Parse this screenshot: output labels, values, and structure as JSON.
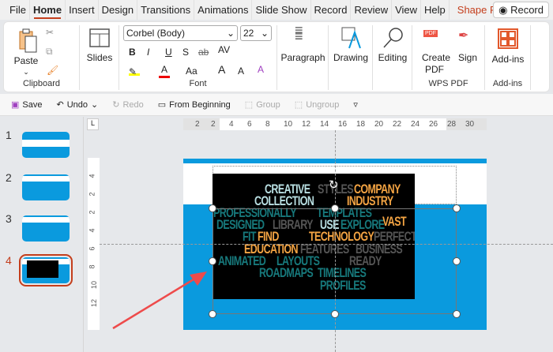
{
  "tabs": [
    "File",
    "Home",
    "Insert",
    "Design",
    "Transitions",
    "Animations",
    "Slide Show",
    "Record",
    "Review",
    "View",
    "Help"
  ],
  "contextual_tab": "Shape Format",
  "record_button": "Record",
  "ribbon": {
    "clipboard": {
      "paste": "Paste",
      "label": "Clipboard"
    },
    "slides": {
      "label": "Slides"
    },
    "font": {
      "name": "Corbel (Body)",
      "size": "22",
      "label": "Font",
      "bold": "B",
      "italic": "I",
      "underline": "U",
      "shadow": "S",
      "strike": "ab",
      "spacing": "AV",
      "case": "Aa",
      "grow": "A",
      "shrink": "A",
      "highlight_color": "#ffff00",
      "font_color": "#e00000"
    },
    "paragraph": "Paragraph",
    "drawing": "Drawing",
    "editing": "Editing",
    "wps": {
      "create": "Create",
      "pdf": "PDF",
      "sign": "Sign",
      "label": "WPS PDF",
      "badge": "PDF"
    },
    "addins": {
      "button": "Add-ins",
      "label": "Add-ins"
    }
  },
  "qat": {
    "save": "Save",
    "undo": "Undo",
    "redo": "Redo",
    "from_beginning": "From Beginning",
    "group": "Group",
    "ungroup": "Ungroup"
  },
  "slides": [
    {
      "num": "1"
    },
    {
      "num": "2"
    },
    {
      "num": "3"
    },
    {
      "num": "4",
      "selected": true
    }
  ],
  "ruler_h": [
    "2",
    "2",
    "4",
    "6",
    "8",
    "10",
    "12",
    "14",
    "16",
    "18",
    "20",
    "22",
    "24",
    "26",
    "28",
    "30"
  ],
  "ruler_v": [
    "4",
    "2",
    "2",
    "4",
    "6",
    "8",
    "10",
    "12"
  ],
  "colors": {
    "accent": "#c43e1c",
    "slide_blue": "#0a9ade",
    "teal": "#17797c",
    "orange": "#f4a443",
    "light": "#b9dfe2",
    "gray": "#555555",
    "arrow": "#ee4b4b"
  },
  "word_cloud": [
    {
      "t": "CREATIVE",
      "c": "light"
    },
    {
      "t": "STYLES",
      "c": "gray"
    },
    {
      "t": "COMPANY",
      "c": "orange"
    },
    {
      "t": "COLLECTION",
      "c": "light"
    },
    {
      "t": "INDUSTRY",
      "c": "orange"
    },
    {
      "t": "PROFESSIONALLY",
      "c": "teal"
    },
    {
      "t": "TEMPLATES",
      "c": "teal"
    },
    {
      "t": "DESIGNED",
      "c": "teal"
    },
    {
      "t": "LIBRARY",
      "c": "gray"
    },
    {
      "t": "USE",
      "c": "light"
    },
    {
      "t": "EXPLORE",
      "c": "teal"
    },
    {
      "t": "VAST",
      "c": "orange"
    },
    {
      "t": "FIT",
      "c": "teal"
    },
    {
      "t": "FIND",
      "c": "orange"
    },
    {
      "t": "TECHNOLOGY",
      "c": "orange"
    },
    {
      "t": "PERFECT",
      "c": "gray"
    },
    {
      "t": "EDUCATION",
      "c": "orange"
    },
    {
      "t": "FEATURES",
      "c": "gray"
    },
    {
      "t": "BUSINESS",
      "c": "gray"
    },
    {
      "t": "ANIMATED",
      "c": "teal"
    },
    {
      "t": "LAYOUTS",
      "c": "teal"
    },
    {
      "t": "READY",
      "c": "gray"
    },
    {
      "t": "ROADMAPS",
      "c": "teal"
    },
    {
      "t": "TIMELINES",
      "c": "teal"
    },
    {
      "t": "PROFILES",
      "c": "teal"
    }
  ]
}
